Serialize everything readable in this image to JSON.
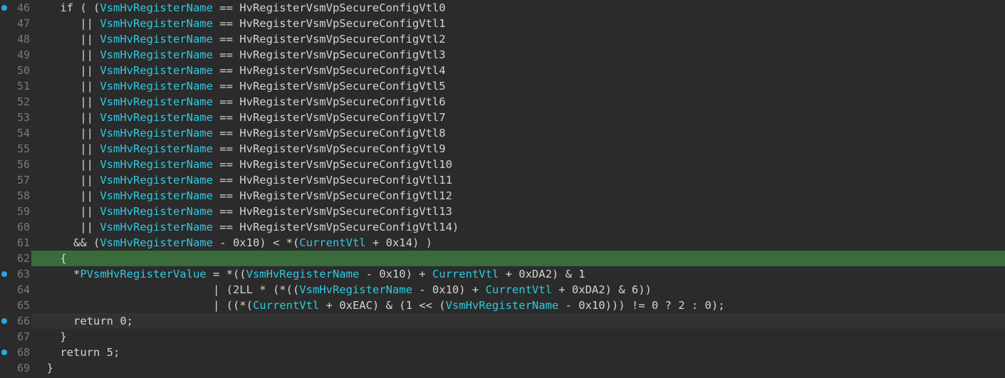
{
  "editor": {
    "lines": [
      {
        "num": "46",
        "bp": true,
        "hl": "",
        "tokens": [
          {
            "t": "    if ( (",
            "c": "plain"
          },
          {
            "t": "VsmHvRegisterName",
            "c": "ident"
          },
          {
            "t": " == HvRegisterVsmVpSecureConfigVtl0",
            "c": "plain"
          }
        ]
      },
      {
        "num": "47",
        "bp": false,
        "hl": "",
        "tokens": [
          {
            "t": "       || ",
            "c": "plain"
          },
          {
            "t": "VsmHvRegisterName",
            "c": "ident"
          },
          {
            "t": " == HvRegisterVsmVpSecureConfigVtl1",
            "c": "plain"
          }
        ]
      },
      {
        "num": "48",
        "bp": false,
        "hl": "",
        "tokens": [
          {
            "t": "       || ",
            "c": "plain"
          },
          {
            "t": "VsmHvRegisterName",
            "c": "ident"
          },
          {
            "t": " == HvRegisterVsmVpSecureConfigVtl2",
            "c": "plain"
          }
        ]
      },
      {
        "num": "49",
        "bp": false,
        "hl": "",
        "tokens": [
          {
            "t": "       || ",
            "c": "plain"
          },
          {
            "t": "VsmHvRegisterName",
            "c": "ident"
          },
          {
            "t": " == HvRegisterVsmVpSecureConfigVtl3",
            "c": "plain"
          }
        ]
      },
      {
        "num": "50",
        "bp": false,
        "hl": "",
        "tokens": [
          {
            "t": "       || ",
            "c": "plain"
          },
          {
            "t": "VsmHvRegisterName",
            "c": "ident"
          },
          {
            "t": " == HvRegisterVsmVpSecureConfigVtl4",
            "c": "plain"
          }
        ]
      },
      {
        "num": "51",
        "bp": false,
        "hl": "",
        "tokens": [
          {
            "t": "       || ",
            "c": "plain"
          },
          {
            "t": "VsmHvRegisterName",
            "c": "ident"
          },
          {
            "t": " == HvRegisterVsmVpSecureConfigVtl5",
            "c": "plain"
          }
        ]
      },
      {
        "num": "52",
        "bp": false,
        "hl": "",
        "tokens": [
          {
            "t": "       || ",
            "c": "plain"
          },
          {
            "t": "VsmHvRegisterName",
            "c": "ident"
          },
          {
            "t": " == HvRegisterVsmVpSecureConfigVtl6",
            "c": "plain"
          }
        ]
      },
      {
        "num": "53",
        "bp": false,
        "hl": "",
        "tokens": [
          {
            "t": "       || ",
            "c": "plain"
          },
          {
            "t": "VsmHvRegisterName",
            "c": "ident"
          },
          {
            "t": " == HvRegisterVsmVpSecureConfigVtl7",
            "c": "plain"
          }
        ]
      },
      {
        "num": "54",
        "bp": false,
        "hl": "",
        "tokens": [
          {
            "t": "       || ",
            "c": "plain"
          },
          {
            "t": "VsmHvRegisterName",
            "c": "ident"
          },
          {
            "t": " == HvRegisterVsmVpSecureConfigVtl8",
            "c": "plain"
          }
        ]
      },
      {
        "num": "55",
        "bp": false,
        "hl": "",
        "tokens": [
          {
            "t": "       || ",
            "c": "plain"
          },
          {
            "t": "VsmHvRegisterName",
            "c": "ident"
          },
          {
            "t": " == HvRegisterVsmVpSecureConfigVtl9",
            "c": "plain"
          }
        ]
      },
      {
        "num": "56",
        "bp": false,
        "hl": "",
        "tokens": [
          {
            "t": "       || ",
            "c": "plain"
          },
          {
            "t": "VsmHvRegisterName",
            "c": "ident"
          },
          {
            "t": " == HvRegisterVsmVpSecureConfigVtl10",
            "c": "plain"
          }
        ]
      },
      {
        "num": "57",
        "bp": false,
        "hl": "",
        "tokens": [
          {
            "t": "       || ",
            "c": "plain"
          },
          {
            "t": "VsmHvRegisterName",
            "c": "ident"
          },
          {
            "t": " == HvRegisterVsmVpSecureConfigVtl11",
            "c": "plain"
          }
        ]
      },
      {
        "num": "58",
        "bp": false,
        "hl": "",
        "tokens": [
          {
            "t": "       || ",
            "c": "plain"
          },
          {
            "t": "VsmHvRegisterName",
            "c": "ident"
          },
          {
            "t": " == HvRegisterVsmVpSecureConfigVtl12",
            "c": "plain"
          }
        ]
      },
      {
        "num": "59",
        "bp": false,
        "hl": "",
        "tokens": [
          {
            "t": "       || ",
            "c": "plain"
          },
          {
            "t": "VsmHvRegisterName",
            "c": "ident"
          },
          {
            "t": " == HvRegisterVsmVpSecureConfigVtl13",
            "c": "plain"
          }
        ]
      },
      {
        "num": "60",
        "bp": false,
        "hl": "",
        "tokens": [
          {
            "t": "       || ",
            "c": "plain"
          },
          {
            "t": "VsmHvRegisterName",
            "c": "ident"
          },
          {
            "t": " == HvRegisterVsmVpSecureConfigVtl14)",
            "c": "plain"
          }
        ]
      },
      {
        "num": "61",
        "bp": false,
        "hl": "",
        "tokens": [
          {
            "t": "      && (",
            "c": "plain"
          },
          {
            "t": "VsmHvRegisterName",
            "c": "ident"
          },
          {
            "t": " - 0x10) < *(",
            "c": "plain"
          },
          {
            "t": "CurrentVtl",
            "c": "ident"
          },
          {
            "t": " + 0x14) )",
            "c": "plain"
          }
        ]
      },
      {
        "num": "62",
        "bp": false,
        "hl": "green",
        "tokens": [
          {
            "t": "    {",
            "c": "plain"
          }
        ]
      },
      {
        "num": "63",
        "bp": true,
        "hl": "",
        "tokens": [
          {
            "t": "      *",
            "c": "plain"
          },
          {
            "t": "PVsmHvRegisterValue",
            "c": "ident"
          },
          {
            "t": " = *((",
            "c": "plain"
          },
          {
            "t": "VsmHvRegisterName",
            "c": "ident"
          },
          {
            "t": " - 0x10) + ",
            "c": "plain"
          },
          {
            "t": "CurrentVtl",
            "c": "ident"
          },
          {
            "t": " + 0xDA2) & 1",
            "c": "plain"
          }
        ]
      },
      {
        "num": "64",
        "bp": false,
        "hl": "",
        "tokens": [
          {
            "t": "                           | (2LL * (*((",
            "c": "plain"
          },
          {
            "t": "VsmHvRegisterName",
            "c": "ident"
          },
          {
            "t": " - 0x10) + ",
            "c": "plain"
          },
          {
            "t": "CurrentVtl",
            "c": "ident"
          },
          {
            "t": " + 0xDA2) & 6))",
            "c": "plain"
          }
        ]
      },
      {
        "num": "65",
        "bp": false,
        "hl": "",
        "tokens": [
          {
            "t": "                           | ((*(",
            "c": "plain"
          },
          {
            "t": "CurrentVtl",
            "c": "ident"
          },
          {
            "t": " + 0xEAC) & (1 << (",
            "c": "plain"
          },
          {
            "t": "VsmHvRegisterName",
            "c": "ident"
          },
          {
            "t": " - 0x10))) != 0 ? 2 : 0);",
            "c": "plain"
          }
        ]
      },
      {
        "num": "66",
        "bp": true,
        "hl": "cursor",
        "tokens": [
          {
            "t": "      return 0;",
            "c": "plain"
          }
        ]
      },
      {
        "num": "67",
        "bp": false,
        "hl": "",
        "tokens": [
          {
            "t": "    }",
            "c": "plain"
          }
        ]
      },
      {
        "num": "68",
        "bp": true,
        "hl": "",
        "tokens": [
          {
            "t": "    return 5;",
            "c": "plain"
          }
        ]
      },
      {
        "num": "69",
        "bp": false,
        "hl": "",
        "tokens": [
          {
            "t": "  }",
            "c": "plain"
          }
        ]
      }
    ]
  },
  "colors": {
    "background": "#2b2b2b",
    "plain_text": "#d4d4d4",
    "identifier": "#2fc9e0",
    "line_number": "#7a7a7a",
    "breakpoint": "#2aa8e0",
    "current_line_highlight": "#3a6b3a"
  }
}
